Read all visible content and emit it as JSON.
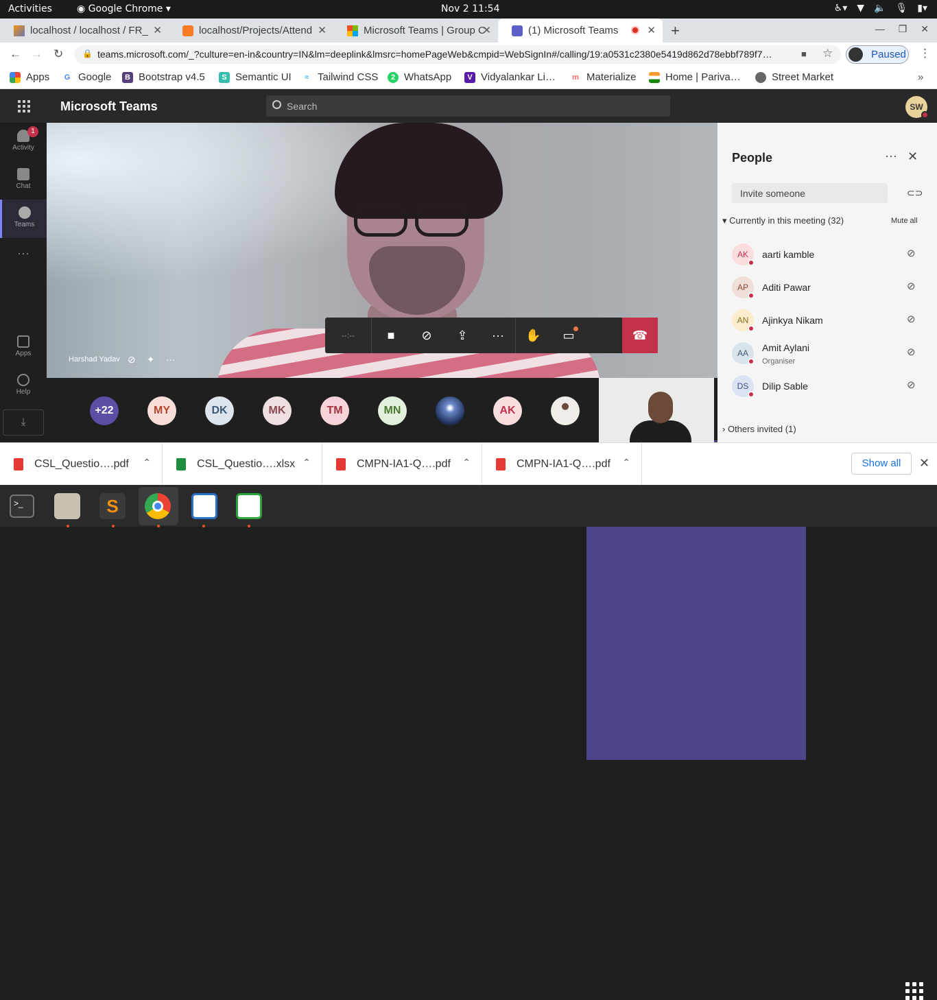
{
  "system_bar": {
    "activities": "Activities",
    "app": "Google Chrome",
    "clock": "Nov 2  11:54"
  },
  "tabs": [
    {
      "title": "localhost / localhost / FR_",
      "icon": "phpmyadmin-icon"
    },
    {
      "title": "localhost/Projects/Attend",
      "icon": "xampp-icon"
    },
    {
      "title": "Microsoft Teams | Group C",
      "icon": "microsoft-icon"
    },
    {
      "title": "(1) Microsoft Teams",
      "icon": "teams-icon"
    }
  ],
  "address": {
    "url": "teams.microsoft.com/_?culture=en-in&country=IN&lm=deeplink&lmsrc=homePageWeb&cmpid=WebSignIn#/calling/19:a0531c2380e5419d862d78ebbf789f7…",
    "profile": "Paused"
  },
  "bookmarks": [
    "Apps",
    "Google",
    "Bootstrap v4.5",
    "Semantic UI",
    "Tailwind CSS",
    "WhatsApp",
    "Vidyalankar Li…",
    "Materialize",
    "Home | Pariva…",
    "Street Market"
  ],
  "teams": {
    "title": "Microsoft Teams",
    "search_placeholder": "Search",
    "user_initials": "SW"
  },
  "rail": [
    {
      "label": "Activity",
      "badge": "1"
    },
    {
      "label": "Chat"
    },
    {
      "label": "Teams"
    },
    {
      "label": "Apps"
    },
    {
      "label": "Help"
    }
  ],
  "video": {
    "speaker": "Harshad Yadav",
    "timer": "--:--"
  },
  "strip": [
    {
      "initials": "+22",
      "bg": "#5b4fa5",
      "fg": "#ffffff"
    },
    {
      "initials": "MY",
      "bg": "#fbded7",
      "fg": "#b2472d"
    },
    {
      "initials": "DK",
      "bg": "#dde4ec",
      "fg": "#3a5a78"
    },
    {
      "initials": "MK",
      "bg": "#efdfe0",
      "fg": "#8a4a53"
    },
    {
      "initials": "TM",
      "bg": "#f5d3d8",
      "fg": "#a3343f"
    },
    {
      "initials": "MN",
      "bg": "#e2f0dc",
      "fg": "#4a7a32"
    },
    {
      "initials": "",
      "bg": "#3b5a9a",
      "fg": "#ffffff"
    },
    {
      "initials": "AK",
      "bg": "#fbdde0",
      "fg": "#c4314b"
    },
    {
      "initials": "",
      "bg": "#f0ece8",
      "fg": "#333333"
    }
  ],
  "people_panel": {
    "title": "People",
    "invite_placeholder": "Invite someone",
    "current_label": "Currently in this meeting (32)",
    "mute_all": "Mute all",
    "others_label": "Others invited (1)",
    "participants": [
      {
        "initials": "AK",
        "name": "aarti kamble",
        "role": "",
        "bg": "#fbdde0",
        "fg": "#c4314b"
      },
      {
        "initials": "AP",
        "name": "Aditi Pawar",
        "role": "",
        "bg": "#efdfd8",
        "fg": "#8a4a33"
      },
      {
        "initials": "AN",
        "name": "Ajinkya Nikam",
        "role": "",
        "bg": "#fbeccd",
        "fg": "#8a6a1a"
      },
      {
        "initials": "AA",
        "name": "Amit Aylani",
        "role": "Organiser",
        "bg": "#d8e3ea",
        "fg": "#3a5a78"
      },
      {
        "initials": "DS",
        "name": "Dilip Sable",
        "role": "",
        "bg": "#dbe3f2",
        "fg": "#3a4f88"
      }
    ]
  },
  "downloads": {
    "files": [
      "CSL_Questio….pdf",
      "CSL_Questio….xlsx",
      "CMPN-IA1-Q….pdf",
      "CMPN-IA1-Q….pdf"
    ],
    "show_all": "Show all"
  }
}
